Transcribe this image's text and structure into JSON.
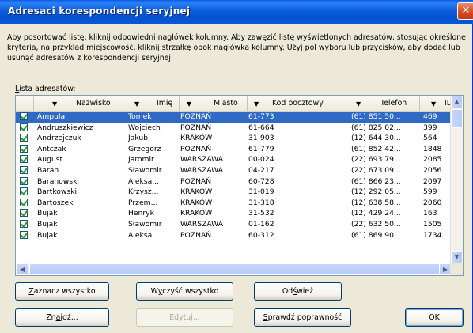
{
  "window": {
    "title": "Adresaci korespondencji seryjnej",
    "close_glyph": "✕"
  },
  "description": "Aby posortować listę, kliknij odpowiedni nagłówek kolumny. Aby zawęzić listę wyświetlonych adresatów, stosując określone kryteria, na przykład miejscowość, kliknij strzałkę obok nagłówka kolumny. Użyj pól wyboru lub przycisków, aby dodać lub usunąć adresatów z korespondencji seryjnej.",
  "list_label_prefix": "L",
  "list_label_rest": "ista adresatów:",
  "columns": [
    {
      "label": "Nazwisko"
    },
    {
      "label": "Imię"
    },
    {
      "label": "Miasto"
    },
    {
      "label": "Kod pocztowy"
    },
    {
      "label": "Telefon"
    },
    {
      "label": "ID"
    }
  ],
  "rows": [
    {
      "checked": true,
      "nazwisko": "Ampuła",
      "imie": "Tomek",
      "miasto": "POZNAŃ",
      "kod": "61-773",
      "telefon": "(61) 851 50...",
      "id": "469",
      "selected": true
    },
    {
      "checked": true,
      "nazwisko": "Andruszkiewicz",
      "imie": "Wojciech",
      "miasto": "POZNAŃ",
      "kod": "61-664",
      "telefon": "(61) 825 02...",
      "id": "399",
      "selected": false
    },
    {
      "checked": true,
      "nazwisko": "Andrzejczuk",
      "imie": "Jakub",
      "miasto": "KRAKÓW",
      "kod": "31-903",
      "telefon": "(12) 644 30...",
      "id": "564",
      "selected": false
    },
    {
      "checked": true,
      "nazwisko": "Antczak",
      "imie": "Grzegorz",
      "miasto": "POZNAŃ",
      "kod": "61-779",
      "telefon": "(61) 852 42...",
      "id": "1848",
      "selected": false
    },
    {
      "checked": true,
      "nazwisko": "August",
      "imie": "Jaromir",
      "miasto": "WARSZAWA",
      "kod": "00-024",
      "telefon": "(22) 693 79...",
      "id": "2085",
      "selected": false
    },
    {
      "checked": true,
      "nazwisko": "Baran",
      "imie": "Sławomir",
      "miasto": "WARSZAWA",
      "kod": "04-217",
      "telefon": "(22) 673 09...",
      "id": "2056",
      "selected": false
    },
    {
      "checked": true,
      "nazwisko": "Baranowski",
      "imie": "Aleksa...",
      "miasto": "POZNAŃ",
      "kod": "60-728",
      "telefon": "(61) 866 23...",
      "id": "2097",
      "selected": false
    },
    {
      "checked": true,
      "nazwisko": "Bartkowski",
      "imie": "Krzysz...",
      "miasto": "KRAKÓW",
      "kod": "31-019",
      "telefon": "(12) 292 05...",
      "id": "599",
      "selected": false
    },
    {
      "checked": true,
      "nazwisko": "Bartoszek",
      "imie": "Przem...",
      "miasto": "KRAKÓW",
      "kod": "31-318",
      "telefon": "(12) 638 58...",
      "id": "2060",
      "selected": false
    },
    {
      "checked": true,
      "nazwisko": "Bujak",
      "imie": "Henryk",
      "miasto": "KRAKÓW",
      "kod": "31-532",
      "telefon": "(12) 429 24...",
      "id": "163",
      "selected": false
    },
    {
      "checked": true,
      "nazwisko": "Bujak",
      "imie": "Sławomir",
      "miasto": "WARSZAWA",
      "kod": "01-162",
      "telefon": "(22) 632 50...",
      "id": "1505",
      "selected": false
    },
    {
      "checked": true,
      "nazwisko": "Bujak",
      "imie": "Aleksa",
      "miasto": "POZNAŃ",
      "kod": "60-312",
      "telefon": "(61) 869 90",
      "id": "1734",
      "selected": false
    }
  ],
  "buttons": {
    "select_all_underline": "Z",
    "select_all_rest": "aznacz wszystko",
    "clear_all_pre": "W",
    "clear_all_underline": "y",
    "clear_all_rest": "czyść wszystko",
    "refresh_pre": "Od",
    "refresh_underline": "ś",
    "refresh_rest": "wież",
    "find_pre": "Zn",
    "find_underline": "a",
    "find_rest": "jdź...",
    "edit": "Edytuj...",
    "validate_underline": "S",
    "validate_rest": "prawdź poprawność",
    "ok": "OK"
  },
  "colors": {
    "title_bar": "#0a5ddc",
    "selection": "#316ac5",
    "dialog_bg": "#ece9d8"
  }
}
